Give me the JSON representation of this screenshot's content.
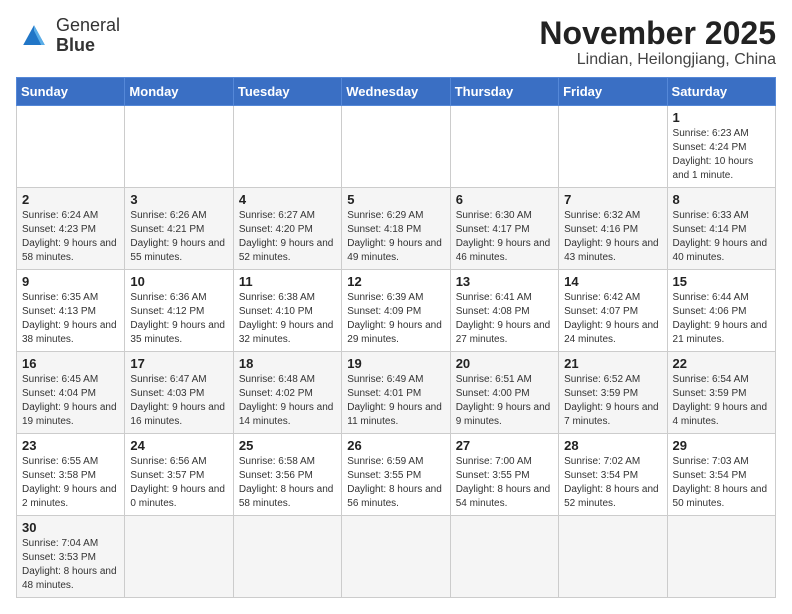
{
  "header": {
    "logo_text_normal": "General",
    "logo_text_bold": "Blue",
    "month": "November 2025",
    "location": "Lindian, Heilongjiang, China"
  },
  "weekdays": [
    "Sunday",
    "Monday",
    "Tuesday",
    "Wednesday",
    "Thursday",
    "Friday",
    "Saturday"
  ],
  "weeks": [
    [
      {
        "day": "",
        "info": ""
      },
      {
        "day": "",
        "info": ""
      },
      {
        "day": "",
        "info": ""
      },
      {
        "day": "",
        "info": ""
      },
      {
        "day": "",
        "info": ""
      },
      {
        "day": "",
        "info": ""
      },
      {
        "day": "1",
        "info": "Sunrise: 6:23 AM\nSunset: 4:24 PM\nDaylight: 10 hours and 1 minute."
      }
    ],
    [
      {
        "day": "2",
        "info": "Sunrise: 6:24 AM\nSunset: 4:23 PM\nDaylight: 9 hours and 58 minutes."
      },
      {
        "day": "3",
        "info": "Sunrise: 6:26 AM\nSunset: 4:21 PM\nDaylight: 9 hours and 55 minutes."
      },
      {
        "day": "4",
        "info": "Sunrise: 6:27 AM\nSunset: 4:20 PM\nDaylight: 9 hours and 52 minutes."
      },
      {
        "day": "5",
        "info": "Sunrise: 6:29 AM\nSunset: 4:18 PM\nDaylight: 9 hours and 49 minutes."
      },
      {
        "day": "6",
        "info": "Sunrise: 6:30 AM\nSunset: 4:17 PM\nDaylight: 9 hours and 46 minutes."
      },
      {
        "day": "7",
        "info": "Sunrise: 6:32 AM\nSunset: 4:16 PM\nDaylight: 9 hours and 43 minutes."
      },
      {
        "day": "8",
        "info": "Sunrise: 6:33 AM\nSunset: 4:14 PM\nDaylight: 9 hours and 40 minutes."
      }
    ],
    [
      {
        "day": "9",
        "info": "Sunrise: 6:35 AM\nSunset: 4:13 PM\nDaylight: 9 hours and 38 minutes."
      },
      {
        "day": "10",
        "info": "Sunrise: 6:36 AM\nSunset: 4:12 PM\nDaylight: 9 hours and 35 minutes."
      },
      {
        "day": "11",
        "info": "Sunrise: 6:38 AM\nSunset: 4:10 PM\nDaylight: 9 hours and 32 minutes."
      },
      {
        "day": "12",
        "info": "Sunrise: 6:39 AM\nSunset: 4:09 PM\nDaylight: 9 hours and 29 minutes."
      },
      {
        "day": "13",
        "info": "Sunrise: 6:41 AM\nSunset: 4:08 PM\nDaylight: 9 hours and 27 minutes."
      },
      {
        "day": "14",
        "info": "Sunrise: 6:42 AM\nSunset: 4:07 PM\nDaylight: 9 hours and 24 minutes."
      },
      {
        "day": "15",
        "info": "Sunrise: 6:44 AM\nSunset: 4:06 PM\nDaylight: 9 hours and 21 minutes."
      }
    ],
    [
      {
        "day": "16",
        "info": "Sunrise: 6:45 AM\nSunset: 4:04 PM\nDaylight: 9 hours and 19 minutes."
      },
      {
        "day": "17",
        "info": "Sunrise: 6:47 AM\nSunset: 4:03 PM\nDaylight: 9 hours and 16 minutes."
      },
      {
        "day": "18",
        "info": "Sunrise: 6:48 AM\nSunset: 4:02 PM\nDaylight: 9 hours and 14 minutes."
      },
      {
        "day": "19",
        "info": "Sunrise: 6:49 AM\nSunset: 4:01 PM\nDaylight: 9 hours and 11 minutes."
      },
      {
        "day": "20",
        "info": "Sunrise: 6:51 AM\nSunset: 4:00 PM\nDaylight: 9 hours and 9 minutes."
      },
      {
        "day": "21",
        "info": "Sunrise: 6:52 AM\nSunset: 3:59 PM\nDaylight: 9 hours and 7 minutes."
      },
      {
        "day": "22",
        "info": "Sunrise: 6:54 AM\nSunset: 3:59 PM\nDaylight: 9 hours and 4 minutes."
      }
    ],
    [
      {
        "day": "23",
        "info": "Sunrise: 6:55 AM\nSunset: 3:58 PM\nDaylight: 9 hours and 2 minutes."
      },
      {
        "day": "24",
        "info": "Sunrise: 6:56 AM\nSunset: 3:57 PM\nDaylight: 9 hours and 0 minutes."
      },
      {
        "day": "25",
        "info": "Sunrise: 6:58 AM\nSunset: 3:56 PM\nDaylight: 8 hours and 58 minutes."
      },
      {
        "day": "26",
        "info": "Sunrise: 6:59 AM\nSunset: 3:55 PM\nDaylight: 8 hours and 56 minutes."
      },
      {
        "day": "27",
        "info": "Sunrise: 7:00 AM\nSunset: 3:55 PM\nDaylight: 8 hours and 54 minutes."
      },
      {
        "day": "28",
        "info": "Sunrise: 7:02 AM\nSunset: 3:54 PM\nDaylight: 8 hours and 52 minutes."
      },
      {
        "day": "29",
        "info": "Sunrise: 7:03 AM\nSunset: 3:54 PM\nDaylight: 8 hours and 50 minutes."
      }
    ],
    [
      {
        "day": "30",
        "info": "Sunrise: 7:04 AM\nSunset: 3:53 PM\nDaylight: 8 hours and 48 minutes."
      },
      {
        "day": "",
        "info": ""
      },
      {
        "day": "",
        "info": ""
      },
      {
        "day": "",
        "info": ""
      },
      {
        "day": "",
        "info": ""
      },
      {
        "day": "",
        "info": ""
      },
      {
        "day": "",
        "info": ""
      }
    ]
  ]
}
